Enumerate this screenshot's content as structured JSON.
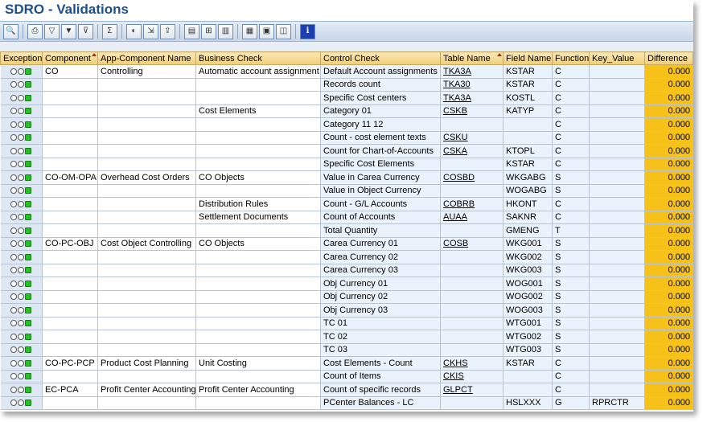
{
  "window": {
    "title": "SDRO - Validations"
  },
  "toolbar": {
    "buttons": [
      {
        "icon": "details-icon",
        "glyph": "🔍"
      },
      {
        "icon": "print-icon",
        "glyph": "⎙"
      },
      {
        "icon": "filter-icon",
        "glyph": "▽"
      },
      {
        "icon": "filter-set-icon",
        "glyph": "▼"
      },
      {
        "icon": "filter-delete-icon",
        "glyph": "⊽"
      },
      {
        "icon": "sum-icon",
        "glyph": "Σ"
      },
      {
        "icon": "views-icon",
        "glyph": "◐"
      },
      {
        "icon": "export-icon",
        "glyph": "⇲"
      },
      {
        "icon": "send-icon",
        "glyph": "⇪"
      },
      {
        "icon": "save-icon",
        "glyph": "▤"
      },
      {
        "icon": "layout-change-icon",
        "glyph": "⊞"
      },
      {
        "icon": "chart-icon",
        "glyph": "▥"
      },
      {
        "icon": "table-view-icon",
        "glyph": "▦"
      },
      {
        "icon": "layout-select-icon",
        "glyph": "▣"
      },
      {
        "icon": "layout-save-icon",
        "glyph": "◫"
      },
      {
        "icon": "information-icon",
        "glyph": "i"
      }
    ]
  },
  "columns": [
    "Exception",
    "Component",
    "App-Component Name",
    "Business Check",
    "Control Check",
    "Table Name",
    "Field Name",
    "Function",
    "Key_Value",
    "Difference"
  ],
  "rows": [
    {
      "component": "CO",
      "app": "Controlling",
      "business": "Automatic account assignment",
      "control": "Default Account assignments",
      "table": "TKA3A",
      "field": "KSTAR",
      "function": "C",
      "key": "",
      "diff": "0.000"
    },
    {
      "component": "",
      "app": "",
      "business": "",
      "control": "Records count",
      "table": "TKA30",
      "field": "KSTAR",
      "function": "C",
      "key": "",
      "diff": "0.000"
    },
    {
      "component": "",
      "app": "",
      "business": "",
      "control": "Specific Cost centers",
      "table": "TKA3A",
      "field": "KOSTL",
      "function": "C",
      "key": "",
      "diff": "0.000"
    },
    {
      "component": "",
      "app": "",
      "business": "Cost Elements",
      "control": "Category 01",
      "table": "CSKB",
      "field": "KATYP",
      "function": "C",
      "key": "",
      "diff": "0.000"
    },
    {
      "component": "",
      "app": "",
      "business": "",
      "control": "Category 11 12",
      "table": "",
      "field": "",
      "function": "C",
      "key": "",
      "diff": "0.000"
    },
    {
      "component": "",
      "app": "",
      "business": "",
      "control": "Count - cost element texts",
      "table": "CSKU",
      "field": "",
      "function": "C",
      "key": "",
      "diff": "0.000"
    },
    {
      "component": "",
      "app": "",
      "business": "",
      "control": "Count for Chart-of-Accounts",
      "table": "CSKA",
      "field": "KTOPL",
      "function": "C",
      "key": "",
      "diff": "0.000"
    },
    {
      "component": "",
      "app": "",
      "business": "",
      "control": "Specific Cost Elements",
      "table": "",
      "field": "KSTAR",
      "function": "C",
      "key": "",
      "diff": "0.000"
    },
    {
      "component": "CO-OM-OPA",
      "app": "Overhead Cost Orders",
      "business": "CO Objects",
      "control": "Value in Carea Currency",
      "table": "COSBD",
      "field": "WKGABG",
      "function": "S",
      "key": "",
      "diff": "0.000"
    },
    {
      "component": "",
      "app": "",
      "business": "",
      "control": "Value in Object Currency",
      "table": "",
      "field": "WOGABG",
      "function": "S",
      "key": "",
      "diff": "0.000"
    },
    {
      "component": "",
      "app": "",
      "business": "Distribution Rules",
      "control": "Count - G/L Accounts",
      "table": "COBRB",
      "field": "HKONT",
      "function": "C",
      "key": "",
      "diff": "0.000"
    },
    {
      "component": "",
      "app": "",
      "business": "Settlement Documents",
      "control": "Count of Accounts",
      "table": "AUAA",
      "field": "SAKNR",
      "function": "C",
      "key": "",
      "diff": "0.000"
    },
    {
      "component": "",
      "app": "",
      "business": "",
      "control": "Total Quantity",
      "table": "",
      "field": "GMENG",
      "function": "T",
      "key": "",
      "diff": "0.000"
    },
    {
      "component": "CO-PC-OBJ",
      "app": "Cost Object Controlling",
      "business": "CO Objects",
      "control": "Carea Currency 01",
      "table": "COSB",
      "field": "WKG001",
      "function": "S",
      "key": "",
      "diff": "0.000"
    },
    {
      "component": "",
      "app": "",
      "business": "",
      "control": "Carea Currency 02",
      "table": "",
      "field": "WKG002",
      "function": "S",
      "key": "",
      "diff": "0.000"
    },
    {
      "component": "",
      "app": "",
      "business": "",
      "control": "Carea Currency 03",
      "table": "",
      "field": "WKG003",
      "function": "S",
      "key": "",
      "diff": "0.000"
    },
    {
      "component": "",
      "app": "",
      "business": "",
      "control": "Obj Currency 01",
      "table": "",
      "field": "WOG001",
      "function": "S",
      "key": "",
      "diff": "0.000"
    },
    {
      "component": "",
      "app": "",
      "business": "",
      "control": "Obj Currency 02",
      "table": "",
      "field": "WOG002",
      "function": "S",
      "key": "",
      "diff": "0.000"
    },
    {
      "component": "",
      "app": "",
      "business": "",
      "control": "Obj Currency 03",
      "table": "",
      "field": "WOG003",
      "function": "S",
      "key": "",
      "diff": "0.000"
    },
    {
      "component": "",
      "app": "",
      "business": "",
      "control": "TC 01",
      "table": "",
      "field": "WTG001",
      "function": "S",
      "key": "",
      "diff": "0.000"
    },
    {
      "component": "",
      "app": "",
      "business": "",
      "control": "TC 02",
      "table": "",
      "field": "WTG002",
      "function": "S",
      "key": "",
      "diff": "0.000"
    },
    {
      "component": "",
      "app": "",
      "business": "",
      "control": "TC 03",
      "table": "",
      "field": "WTG003",
      "function": "S",
      "key": "",
      "diff": "0.000"
    },
    {
      "component": "CO-PC-PCP",
      "app": "Product Cost Planning",
      "business": "Unit Costing",
      "control": "Cost Elements - Count",
      "table": "CKHS",
      "field": "KSTAR",
      "function": "C",
      "key": "",
      "diff": "0.000"
    },
    {
      "component": "",
      "app": "",
      "business": "",
      "control": "Count of Items",
      "table": "CKIS",
      "field": "",
      "function": "C",
      "key": "",
      "diff": "0.000"
    },
    {
      "component": "EC-PCA",
      "app": "Profit Center Accounting",
      "business": "Profit Center Accounting",
      "control": "Count of specific records",
      "table": "GLPCT",
      "field": "",
      "function": "C",
      "key": "",
      "diff": "0.000"
    },
    {
      "component": "",
      "app": "",
      "business": "",
      "control": "PCenter Balances - LC",
      "table": "",
      "field": "HSLXXX",
      "function": "G",
      "key": "RPRCTR",
      "diff": "0.000"
    }
  ]
}
